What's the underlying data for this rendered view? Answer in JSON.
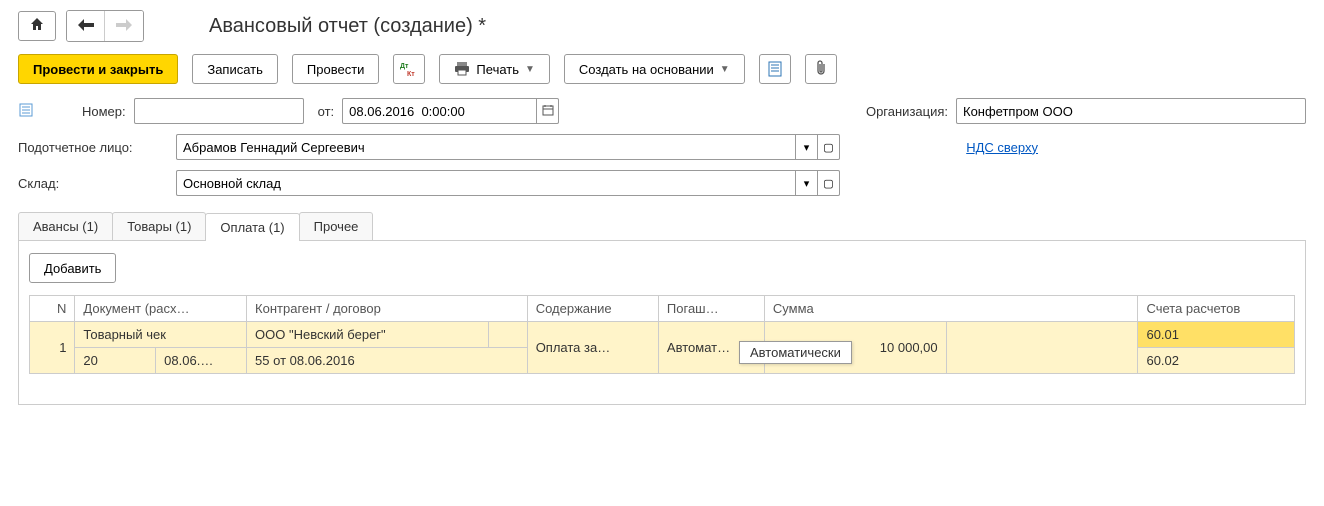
{
  "header": {
    "title": "Авансовый отчет (создание) *"
  },
  "toolbar": {
    "post_close": "Провести и закрыть",
    "save": "Записать",
    "post": "Провести",
    "print": "Печать",
    "create_based": "Создать на основании"
  },
  "form": {
    "number_label": "Номер:",
    "number_value": "",
    "date_label": "от:",
    "date_value": "08.06.2016  0:00:00",
    "org_label": "Организация:",
    "org_value": "Конфетпром ООО",
    "person_label": "Подотчетное лицо:",
    "person_value": "Абрамов Геннадий Сергеевич",
    "vat_link": "НДС сверху",
    "warehouse_label": "Склад:",
    "warehouse_value": "Основной склад"
  },
  "tabs": {
    "advances": "Авансы (1)",
    "goods": "Товары (1)",
    "payment": "Оплата (1)",
    "other": "Прочее",
    "add_btn": "Добавить"
  },
  "table": {
    "cols": {
      "n": "N",
      "doc": "Документ (расх…",
      "contr": "Контрагент / договор",
      "content": "Содержание",
      "repay": "Погаш…",
      "sum": "Сумма",
      "accounts": "Счета расчетов"
    },
    "row": {
      "n": "1",
      "doc_type": "Товарный чек",
      "doc_num": "20",
      "doc_date": "08.06.…",
      "counterparty": "ООО \"Невский берег\"",
      "contract": "55 от 08.06.2016",
      "content": "Оплата за…",
      "repay": "Автомат…",
      "sum": "10 000,00",
      "acc1": "60.01",
      "acc2": "60.02"
    }
  },
  "tooltip": "Автоматически"
}
